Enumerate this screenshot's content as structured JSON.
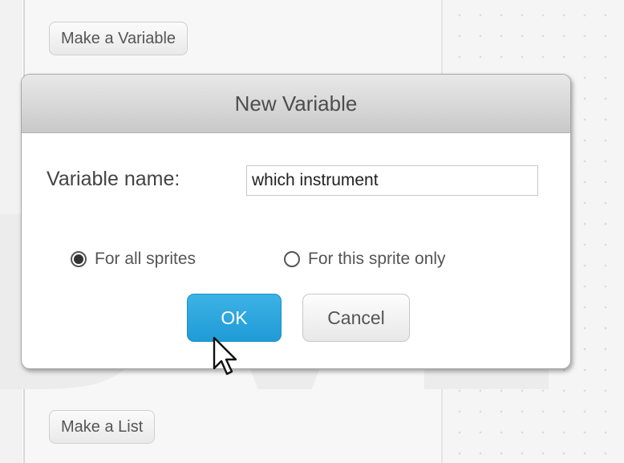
{
  "palette": {
    "make_variable_label": "Make a Variable",
    "make_list_label": "Make a List"
  },
  "dialog": {
    "title": "New Variable",
    "name_label": "Variable name:",
    "name_value": "which instrument",
    "scope_options": [
      {
        "label": "For all sprites",
        "selected": true
      },
      {
        "label": "For this sprite only",
        "selected": false
      }
    ],
    "ok_label": "OK",
    "cancel_label": "Cancel"
  },
  "cursor": {
    "icon": "arrow-cursor-icon"
  },
  "colors": {
    "ok_button": "#1f9bd6",
    "dialog_header": "#d4d4d4"
  }
}
